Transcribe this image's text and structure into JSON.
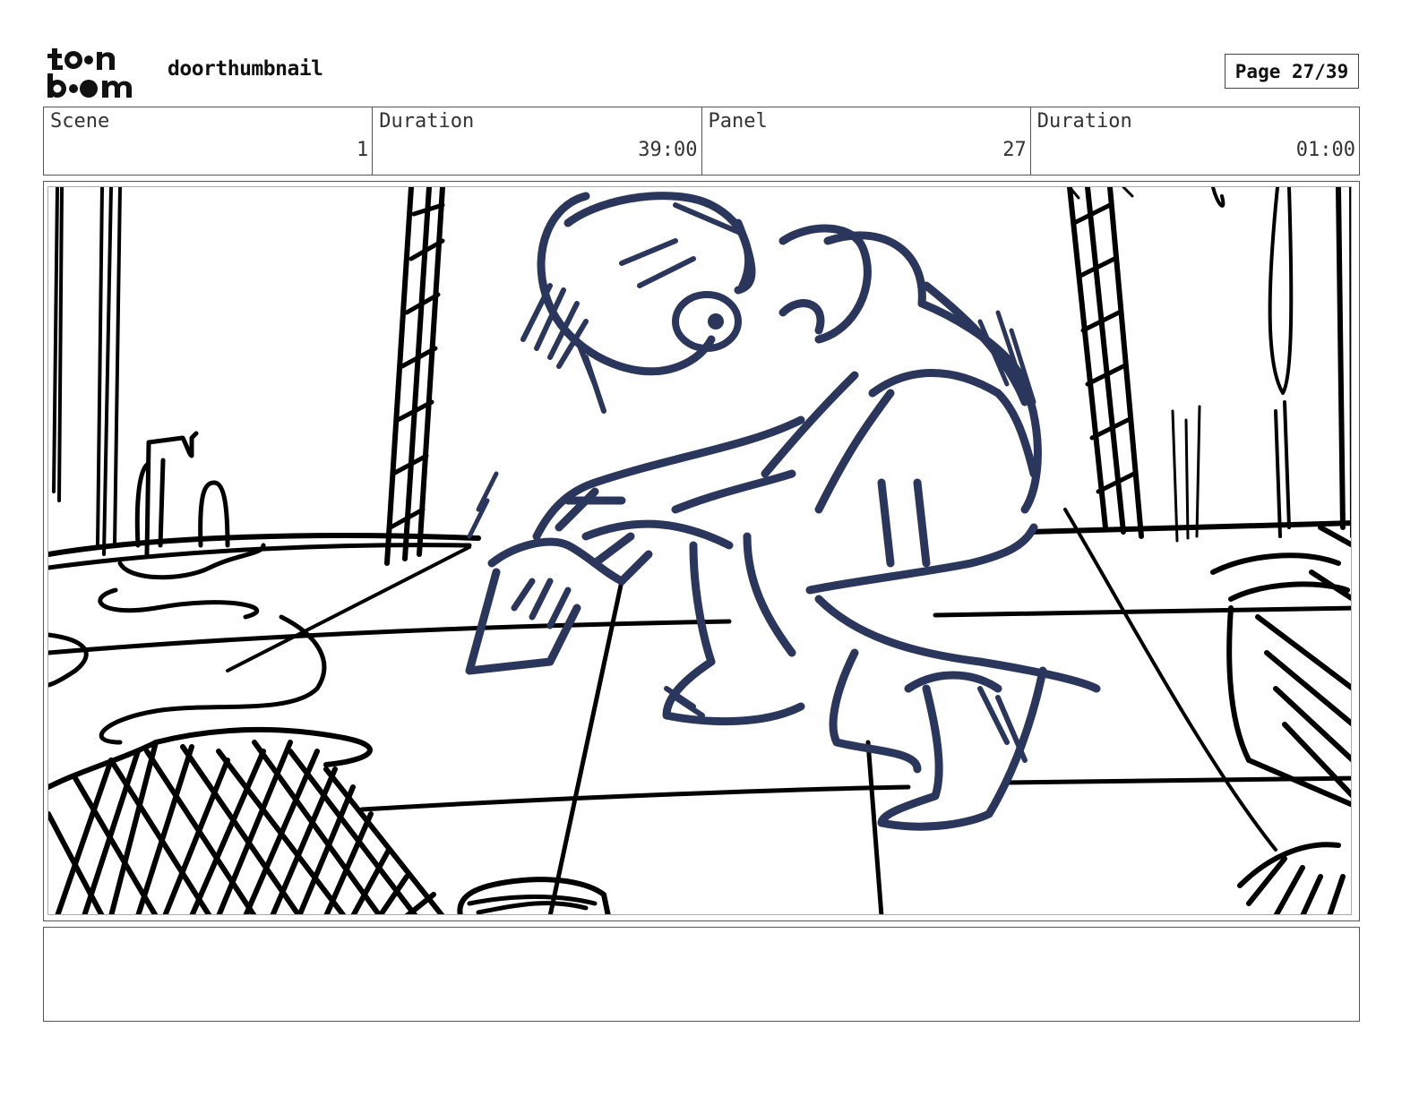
{
  "header": {
    "logo_text": "toon boom",
    "project_title": "doorthumbnail",
    "page_label": "Page 27/39"
  },
  "info": {
    "scene_label": "Scene",
    "scene_value": "1",
    "scene_duration_label": "Duration",
    "scene_duration_value": "39:00",
    "panel_label": "Panel",
    "panel_value": "27",
    "panel_duration_label": "Duration",
    "panel_duration_value": "01:00"
  },
  "panel": {
    "line_color": "#000000",
    "character_color": "#2b365c"
  },
  "notes": {
    "text": ""
  }
}
